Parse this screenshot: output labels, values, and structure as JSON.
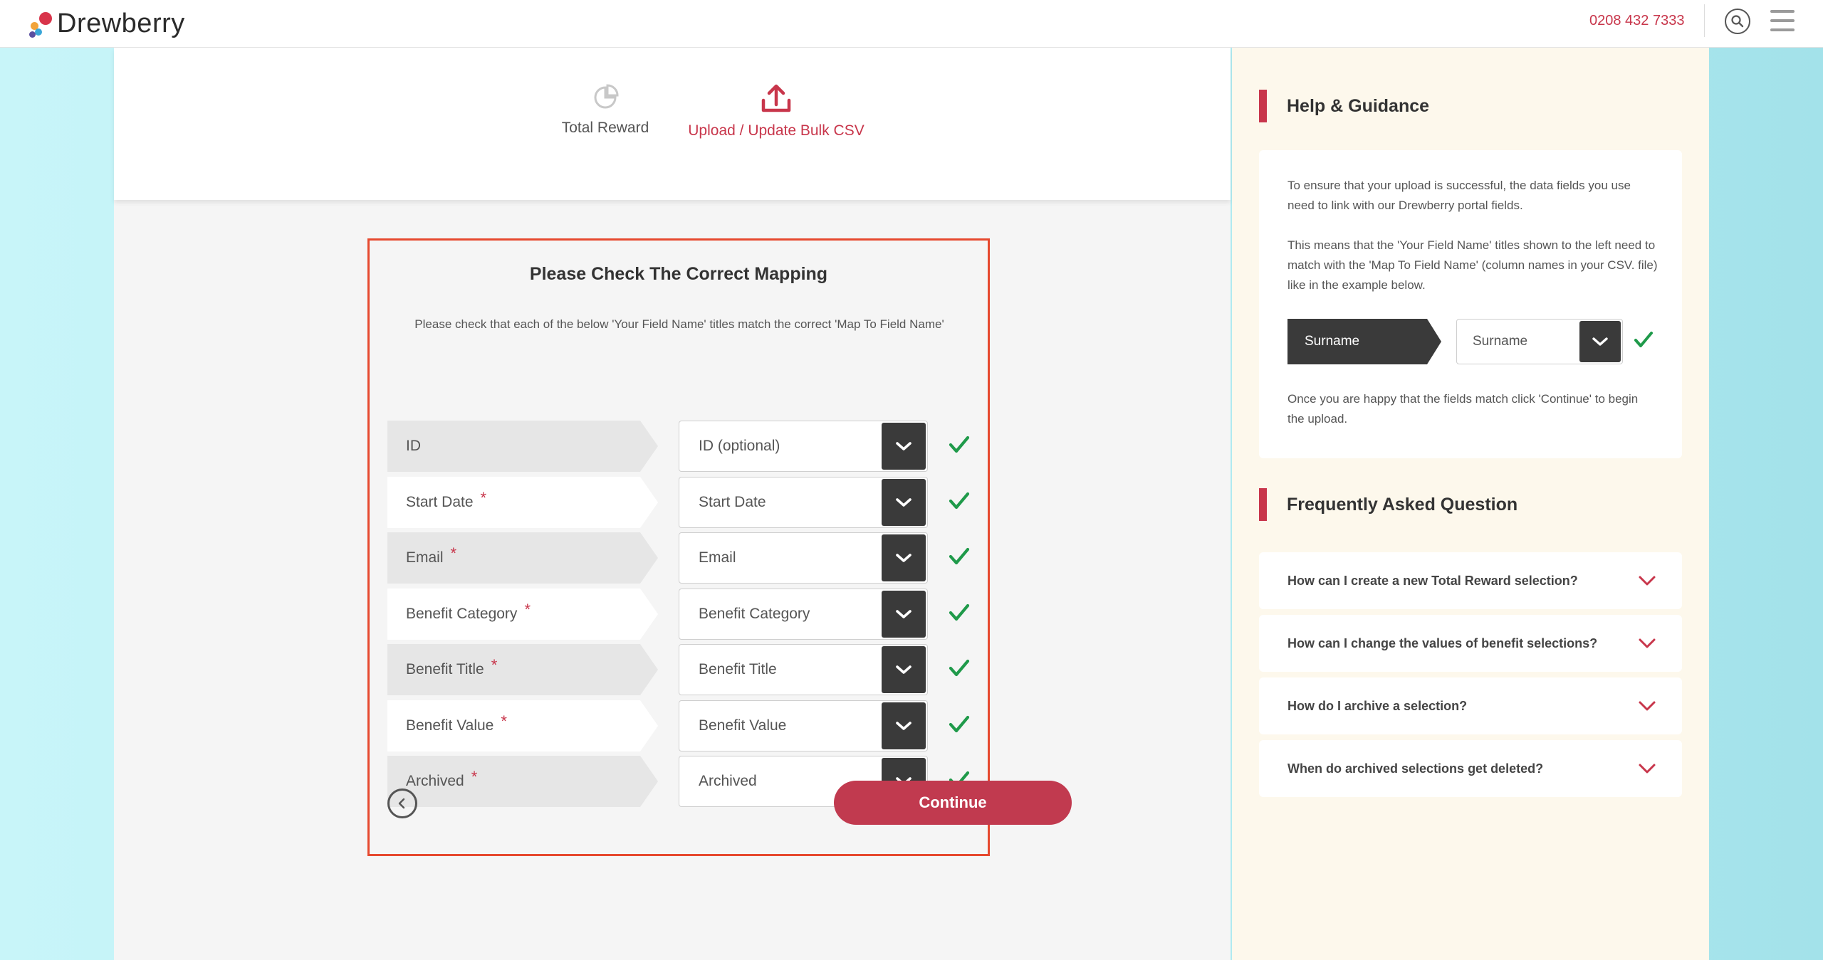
{
  "header": {
    "brand": "Drewberry",
    "phone": "0208 432 7333"
  },
  "tabs": [
    {
      "label": "Total Reward",
      "icon": "pie-chart-icon",
      "active": false
    },
    {
      "label": "Upload / Update Bulk CSV",
      "icon": "upload-icon",
      "active": true
    }
  ],
  "mapping": {
    "title": "Please Check The Correct Mapping",
    "description": "Please check that each of the below 'Your Field Name' titles match the correct 'Map To Field Name'",
    "required_marker": "*",
    "rows": [
      {
        "field": "ID",
        "required": false,
        "selected": "ID (optional)"
      },
      {
        "field": "Start Date",
        "required": true,
        "selected": "Start Date"
      },
      {
        "field": "Email",
        "required": true,
        "selected": "Email"
      },
      {
        "field": "Benefit Category",
        "required": true,
        "selected": "Benefit Category"
      },
      {
        "field": "Benefit Title",
        "required": true,
        "selected": "Benefit Title"
      },
      {
        "field": "Benefit Value",
        "required": true,
        "selected": "Benefit Value"
      },
      {
        "field": "Archived",
        "required": true,
        "selected": "Archived"
      }
    ],
    "continue_label": "Continue"
  },
  "help": {
    "title": "Help & Guidance",
    "p1": "To ensure that your upload is successful, the data fields you use need to link with our Drewberry portal fields.",
    "p2": "This means that the 'Your Field Name' titles shown to the left need to match with the 'Map To Field Name' (column names in your CSV. file) like in the example below.",
    "example_field": "Surname",
    "example_selected": "Surname",
    "p3": "Once you are happy that the fields match click 'Continue' to begin the upload."
  },
  "faq": {
    "title": "Frequently Asked Question",
    "items": [
      "How can I create a new Total Reward selection?",
      "How can I change the values of benefit selections?",
      "How do I archive a selection?",
      "When do archived selections get deleted?"
    ]
  },
  "colors": {
    "accent": "#c8364b",
    "button": "#c13a4f",
    "highlight_border": "#e6492f",
    "check": "#1f9a4a",
    "dark": "#3a3a3a"
  }
}
